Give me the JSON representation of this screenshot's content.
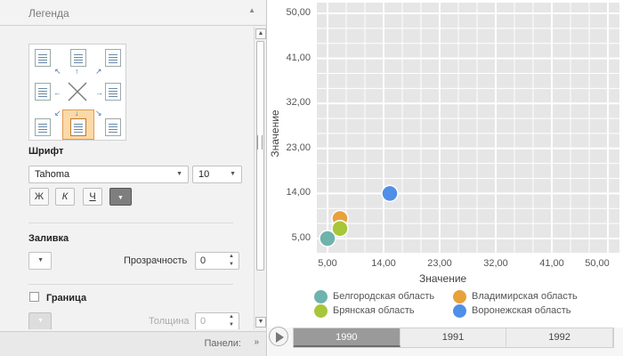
{
  "legend_panel": {
    "title": "Легенда",
    "font_section": {
      "label": "Шрифт",
      "font_family": "Tahoma",
      "font_size": "10",
      "bold_label": "Ж",
      "italic_label": "К",
      "underline_label": "Ч"
    },
    "fill_section": {
      "label": "Заливка",
      "transparency_label": "Прозрачность",
      "transparency_value": "0"
    },
    "border_section": {
      "label": "Граница",
      "thickness_label": "Толщина",
      "thickness_value": "0"
    },
    "footer": {
      "panels_label": "Панели:"
    }
  },
  "chart_data": {
    "type": "scatter",
    "title": "",
    "xlabel": "Значение",
    "ylabel": "Значение",
    "xlim": [
      5,
      50
    ],
    "ylim": [
      5,
      50
    ],
    "x_ticks": [
      "5,00",
      "14,00",
      "23,00",
      "32,00",
      "41,00",
      "50,00"
    ],
    "y_ticks": [
      "5,00",
      "14,00",
      "23,00",
      "32,00",
      "41,00",
      "50,00"
    ],
    "grid": true,
    "legend_position": "bottom",
    "series": [
      {
        "name": "Белгородская область",
        "color": "#6fb3ad",
        "x": 5.0,
        "y": 5.0
      },
      {
        "name": "Владимирская область",
        "color": "#e8a23a",
        "x": 7.0,
        "y": 9.0
      },
      {
        "name": "Брянская область",
        "color": "#a8c63a",
        "x": 7.0,
        "y": 7.0
      },
      {
        "name": "Воронежская область",
        "color": "#4f8fe8",
        "x": 15.0,
        "y": 14.0
      }
    ]
  },
  "timeline": {
    "years": [
      "1990",
      "1991",
      "1992"
    ],
    "active": "1990"
  }
}
